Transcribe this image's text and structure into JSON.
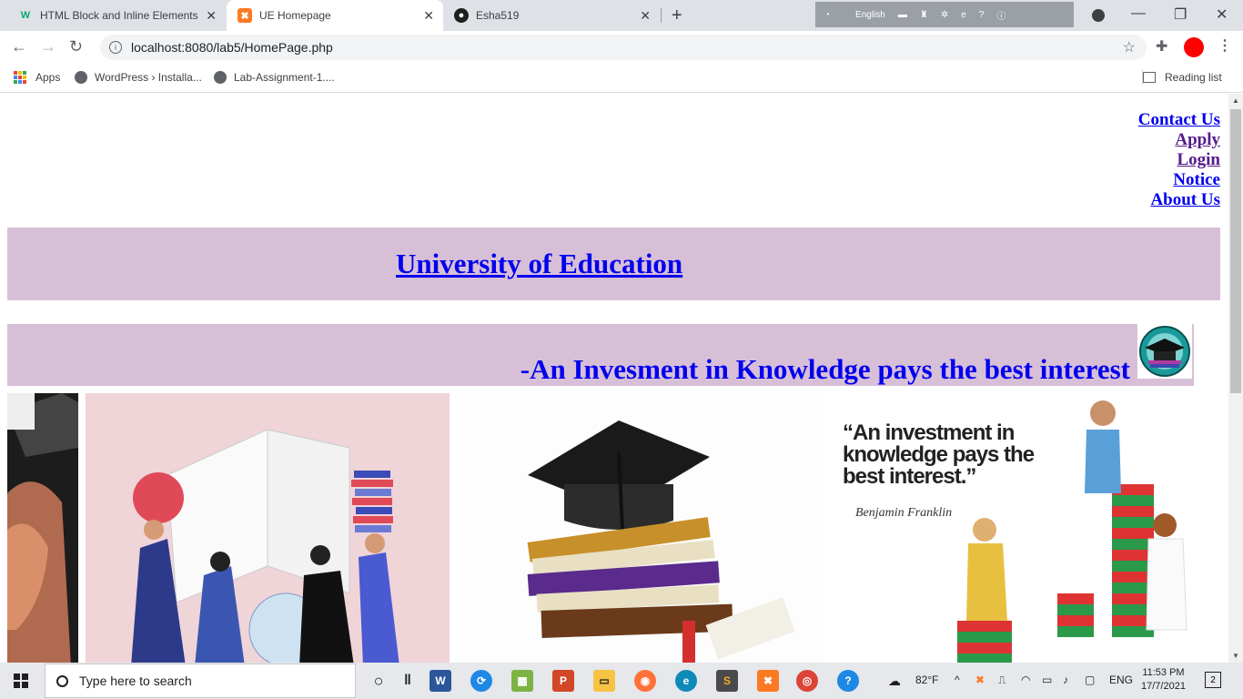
{
  "browser": {
    "tabs": [
      {
        "title": "HTML Block and Inline Elements",
        "favicon": "w3schools-icon",
        "active": false
      },
      {
        "title": "UE Homepage",
        "favicon": "xampp-icon",
        "active": true
      },
      {
        "title": "Esha519",
        "favicon": "github-icon",
        "active": false
      }
    ],
    "ime_language": "English",
    "url": "localhost:8080/lab5/HomePage.php",
    "bookmarks": [
      {
        "label": "Apps",
        "icon": "apps-grid-icon"
      },
      {
        "label": "WordPress › Installa...",
        "icon": "globe-icon"
      },
      {
        "label": "Lab-Assignment-1....",
        "icon": "globe-icon"
      }
    ],
    "reading_list": "Reading list"
  },
  "page": {
    "nav_links": [
      {
        "label": "Contact Us",
        "visited": false
      },
      {
        "label": "Apply",
        "visited": true
      },
      {
        "label": "Login",
        "visited": true
      },
      {
        "label": "Notice",
        "visited": false
      },
      {
        "label": "About Us",
        "visited": false
      }
    ],
    "title": "University of Education",
    "motto": "-An Invesment in Knowledge pays the best interest",
    "gallery_quote": "“An investment in knowledge pays the best interest.”",
    "gallery_quote_author": "Benjamin Franklin",
    "colors": {
      "banner": "#d8bfd8",
      "link": "#0000ee",
      "visited": "#551a8b"
    }
  },
  "taskbar": {
    "search_placeholder": "Type here to search",
    "weather": "82°F",
    "language": "ENG",
    "time": "11:53 PM",
    "date": "17/7/2021",
    "notifications": "2"
  }
}
